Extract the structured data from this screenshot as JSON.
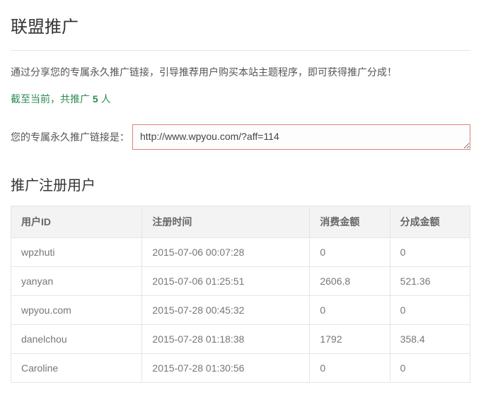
{
  "title": "联盟推广",
  "intro": "通过分享您的专属永久推广链接，引导推荐用户购买本站主题程序，即可获得推广分成！",
  "count_line": {
    "prefix": "截至当前，共推广 ",
    "num": "5",
    "suffix": " 人"
  },
  "link_label": "您的专属永久推广链接是：",
  "link_value": "http://www.wpyou.com/?aff=114",
  "users_title": "推广注册用户",
  "table_headers": {
    "id": "用户ID",
    "time": "注册时间",
    "spend": "消费金额",
    "comm": "分成金额"
  },
  "rows": [
    {
      "id": "wpzhuti",
      "time": "2015-07-06 00:07:28",
      "spend": "0",
      "comm": "0"
    },
    {
      "id": "yanyan",
      "time": "2015-07-06 01:25:51",
      "spend": "2606.8",
      "comm": "521.36"
    },
    {
      "id": "wpyou.com",
      "time": "2015-07-28 00:45:32",
      "spend": "0",
      "comm": "0"
    },
    {
      "id": "danelchou",
      "time": "2015-07-28 01:18:38",
      "spend": "1792",
      "comm": "358.4"
    },
    {
      "id": "Caroline",
      "time": "2015-07-28 01:30:56",
      "spend": "0",
      "comm": "0"
    }
  ]
}
